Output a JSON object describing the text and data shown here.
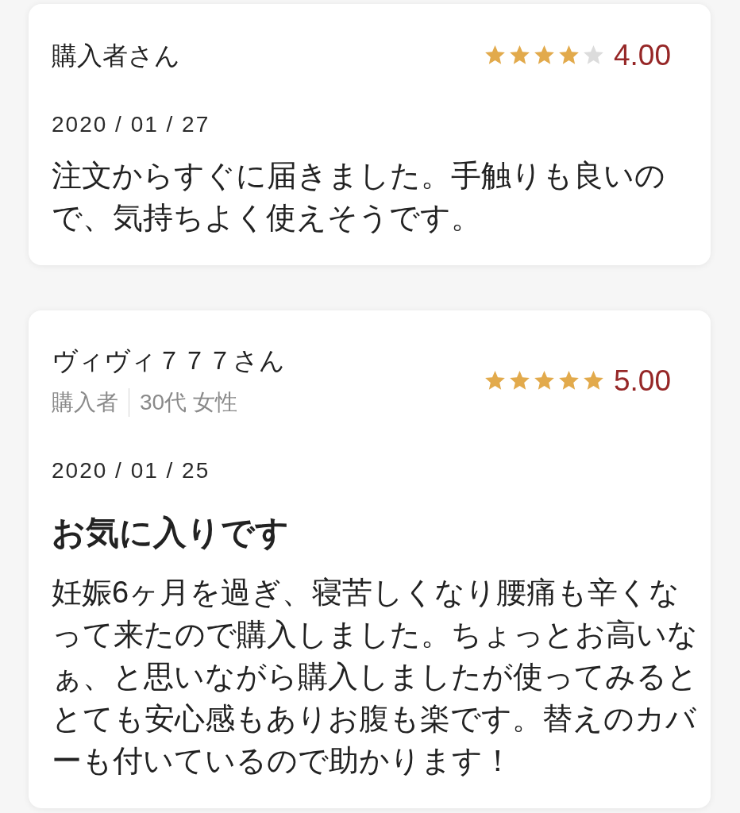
{
  "reviews": [
    {
      "reviewer": "購入者さん",
      "stars": 4,
      "score": "4.00",
      "date": "2020 / 01 / 27",
      "body": "注文からすぐに届きました。手触りも良いので、気持ちよく使えそうです。"
    },
    {
      "reviewer": "ヴィヴィ７７７さん",
      "meta": [
        "購入者",
        "30代 女性"
      ],
      "stars": 5,
      "score": "5.00",
      "date": "2020 / 01 / 25",
      "title": "お気に入りです",
      "body": "妊娠6ヶ月を過ぎ、寝苦しくなり腰痛も辛くなって来たので購入しました。ちょっとお高いなぁ、と思いながら購入しましたが使ってみるととても安心感もありお腹も楽です。替えのカバーも付いているので助かります！"
    }
  ]
}
